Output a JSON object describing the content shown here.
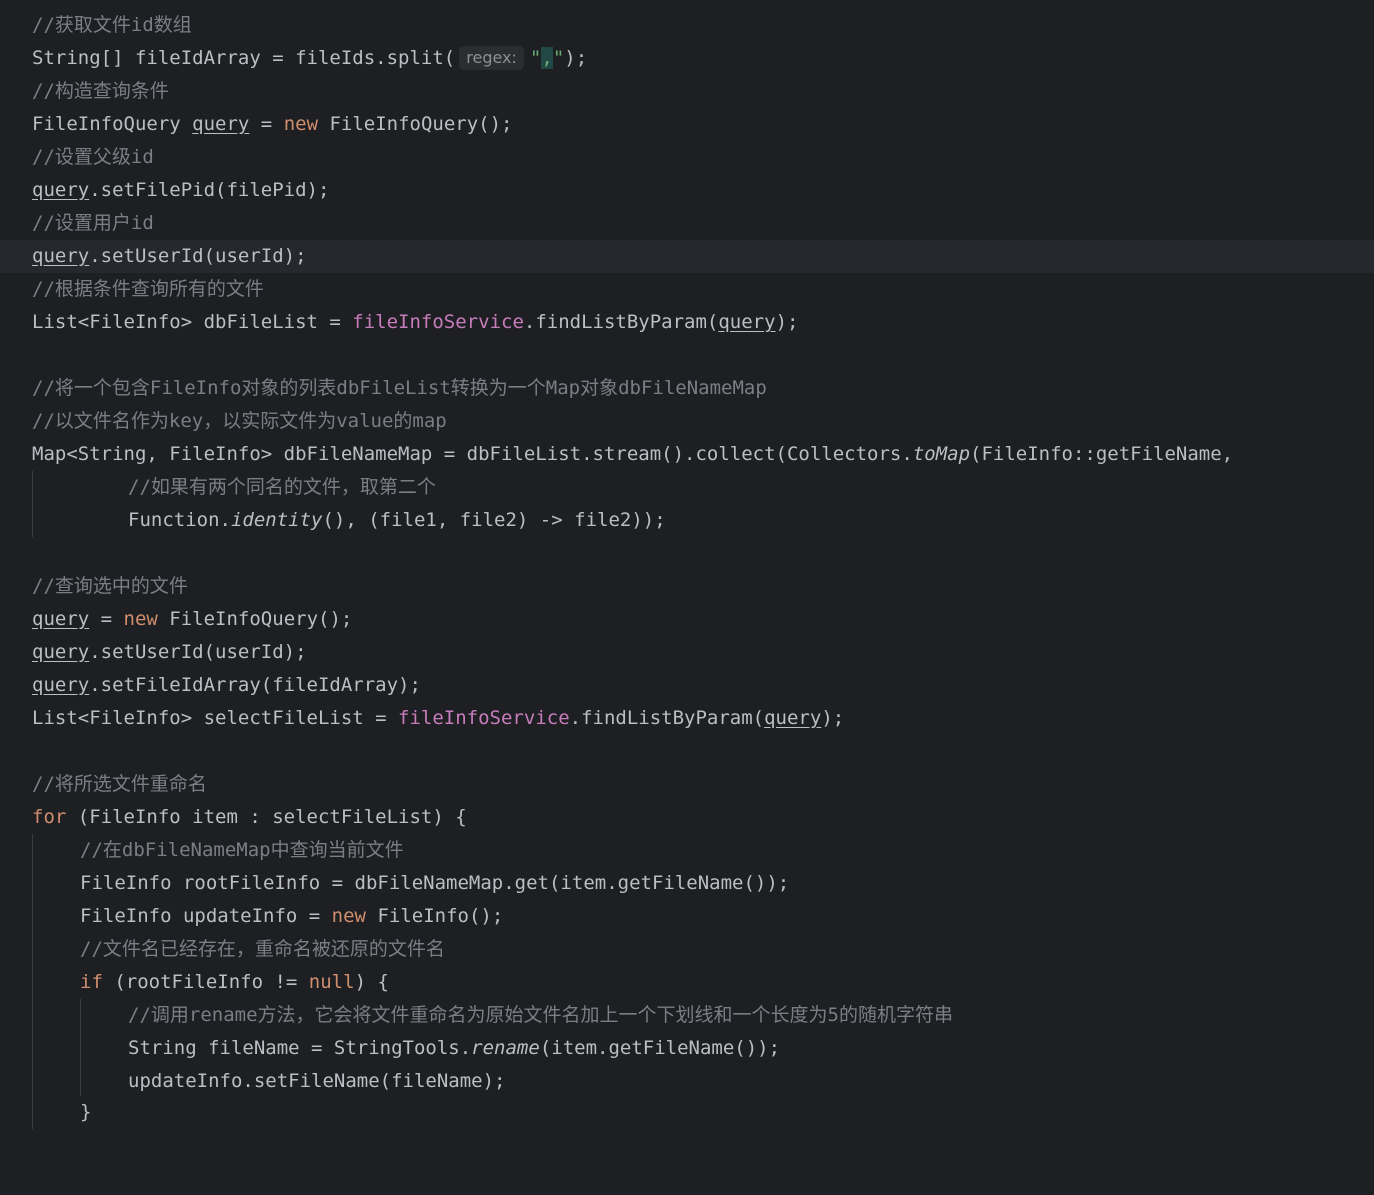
{
  "lines": {
    "l1_comment": "//获取文件id数组",
    "l2_a": "String[] fileIdArray = fileIds.split(",
    "l2_hint": "regex:",
    "l2_q1": "\"",
    "l2_comma": ",",
    "l2_q2": "\"",
    "l2_end": ");",
    "l3_comment": "//构造查询条件",
    "l4_type": "FileInfoQuery ",
    "l4_var": "query",
    "l4_eq": " = ",
    "l4_new": "new",
    "l4_rest": " FileInfoQuery();",
    "l5_comment": "//设置父级id",
    "l6_var": "query",
    "l6_rest": ".setFilePid(filePid);",
    "l7_comment": "//设置用户id",
    "l8_var": "query",
    "l8_rest": ".setUserId(userId);",
    "l9_comment": "//根据条件查询所有的文件",
    "l10_a": "List<FileInfo> dbFileList = ",
    "l10_field": "fileInfoService",
    "l10_b": ".findListByParam(",
    "l10_var": "query",
    "l10_end": ");",
    "l12_comment": "//将一个包含FileInfo对象的列表dbFileList转换为一个Map对象dbFileNameMap",
    "l13_comment": "//以文件名作为key，以实际文件为value的map",
    "l14_a": "Map<String, FileInfo> dbFileNameMap = dbFileList.stream().collect(Collectors.",
    "l14_it": "toMap",
    "l14_b": "(FileInfo::getFileName,",
    "l15_comment": "//如果有两个同名的文件，取第二个",
    "l16_a": "Function.",
    "l16_it": "identity",
    "l16_b": "(), (file1, file2) -> file2));",
    "l18_comment": "//查询选中的文件",
    "l19_var": "query",
    "l19_eq": " = ",
    "l19_new": "new",
    "l19_rest": " FileInfoQuery();",
    "l20_var": "query",
    "l20_rest": ".setUserId(userId);",
    "l21_var": "query",
    "l21_rest": ".setFileIdArray(fileIdArray);",
    "l22_a": "List<FileInfo> selectFileList = ",
    "l22_field": "fileInfoService",
    "l22_b": ".findListByParam(",
    "l22_var": "query",
    "l22_end": ");",
    "l24_comment": "//将所选文件重命名",
    "l25_for": "for",
    "l25_rest": " (FileInfo item : selectFileList) {",
    "l26_comment": "//在dbFileNameMap中查询当前文件",
    "l27_a": "FileInfo rootFileInfo = dbFileNameMap.get(item.getFileName());",
    "l28_a": "FileInfo updateInfo = ",
    "l28_new": "new",
    "l28_b": " FileInfo();",
    "l29_comment": "//文件名已经存在，重命名被还原的文件名",
    "l30_if": "if",
    "l30_a": " (rootFileInfo != ",
    "l30_null": "null",
    "l30_b": ") {",
    "l31_comment": "//调用rename方法，它会将文件重命名为原始文件名加上一个下划线和一个长度为5的随机字符串",
    "l32_a": "String fileName = StringTools.",
    "l32_it": "rename",
    "l32_b": "(item.getFileName());",
    "l33_a": "updateInfo.setFileName(fileName);",
    "l34_a": "}"
  }
}
